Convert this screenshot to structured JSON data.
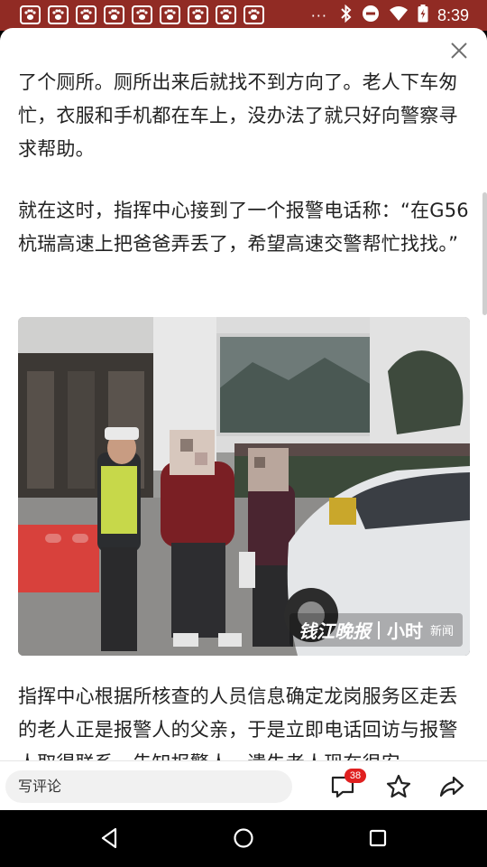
{
  "status_bar": {
    "time": "8:39",
    "overflow": "···",
    "notification_icons": [
      "paw-icon",
      "paw-icon",
      "paw-icon",
      "paw-icon",
      "paw-icon",
      "paw-icon",
      "paw-icon",
      "paw-icon",
      "paw-icon"
    ],
    "system_icons": [
      "bluetooth-icon",
      "do-not-disturb-icon",
      "wifi-icon",
      "battery-icon"
    ],
    "background": "#912b24"
  },
  "article": {
    "paragraphs": [
      "了个厕所。厕所出来后就找不到方向了。老人下车匆忙，衣服和手机都在车上，没办法了就只好向警察寻求帮助。",
      "就在这时，指挥中心接到了一个报警电话称：“在G56杭瑞高速上把爸爸弄丢了，希望高速交警帮忙找找。”",
      "指挥中心根据所核查的人员信息确定龙岗服务区走丢的老人正是报警人的父亲，于是立即电话回访与报警人取得联系，告知报警人，遗失老人现在很安"
    ],
    "photo": {
      "watermark_brand": "钱江晚报",
      "watermark_app": "小时",
      "watermark_suffix": "新闻"
    }
  },
  "bottom_bar": {
    "comment_placeholder": "写评论",
    "comment_count": "38"
  },
  "nav_bar": {
    "buttons": [
      "back-icon",
      "home-icon",
      "recents-icon"
    ]
  }
}
